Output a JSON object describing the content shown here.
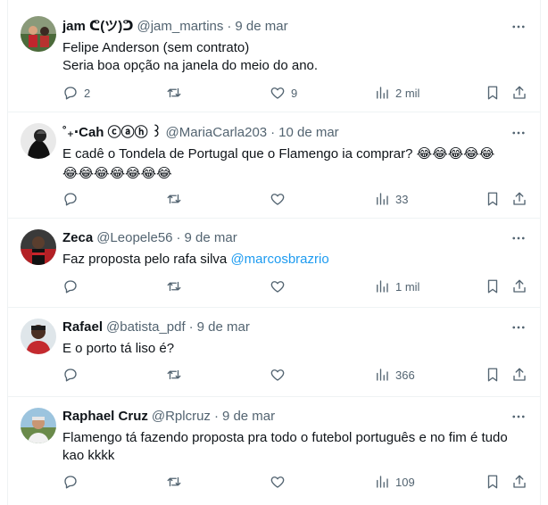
{
  "tweets": [
    {
      "name": "jam ᕦ(ツ)ᕤ",
      "handle": "@jam_martins",
      "separator": "·",
      "date": "9 de mar",
      "lines": [
        "Felipe Anderson (sem contrato)",
        "Seria boa opção na janela do meio do ano."
      ],
      "replies": "2",
      "retweets": "",
      "likes": "9",
      "views": "2 mil"
    },
    {
      "name": "˚₊‧Cah ⓒⓐⓗ ꒱",
      "handle": "@MariaCarla203",
      "separator": "·",
      "date": "10 de mar",
      "lines": [
        "E cadê o Tondela de Portugal que o Flamengo ia comprar? 😂😂😂😂😂",
        "😂😂😂😂😂😂😂"
      ],
      "replies": "",
      "retweets": "",
      "likes": "",
      "views": "33"
    },
    {
      "name": "Zeca",
      "handle": "@Leopele56",
      "separator": "·",
      "date": "9 de mar",
      "text_prefix": "Faz proposta pelo rafa silva ",
      "mention": "@marcosbrazrio",
      "replies": "",
      "retweets": "",
      "likes": "",
      "views": "1 mil"
    },
    {
      "name": "Rafael",
      "handle": "@batista_pdf",
      "separator": "·",
      "date": "9 de mar",
      "lines": [
        "E o porto tá liso é?"
      ],
      "replies": "",
      "retweets": "",
      "likes": "",
      "views": "366"
    },
    {
      "name": "Raphael Cruz",
      "handle": "@Rplcruz",
      "separator": "·",
      "date": "9 de mar",
      "lines": [
        "Flamengo tá fazendo proposta pra todo o futebol português e no fim é tudo",
        "kao kkkk"
      ],
      "replies": "",
      "retweets": "",
      "likes": "",
      "views": "109"
    }
  ],
  "icons": {
    "more": "more-horizontal-icon",
    "reply": "reply-icon",
    "retweet": "retweet-icon",
    "like": "heart-icon",
    "views": "views-icon",
    "bookmark": "bookmark-icon",
    "share": "share-icon"
  },
  "colors": {
    "text": "#0f1419",
    "secondary": "#536471",
    "mention": "#1d9bf0",
    "divider": "#eff3f4"
  }
}
